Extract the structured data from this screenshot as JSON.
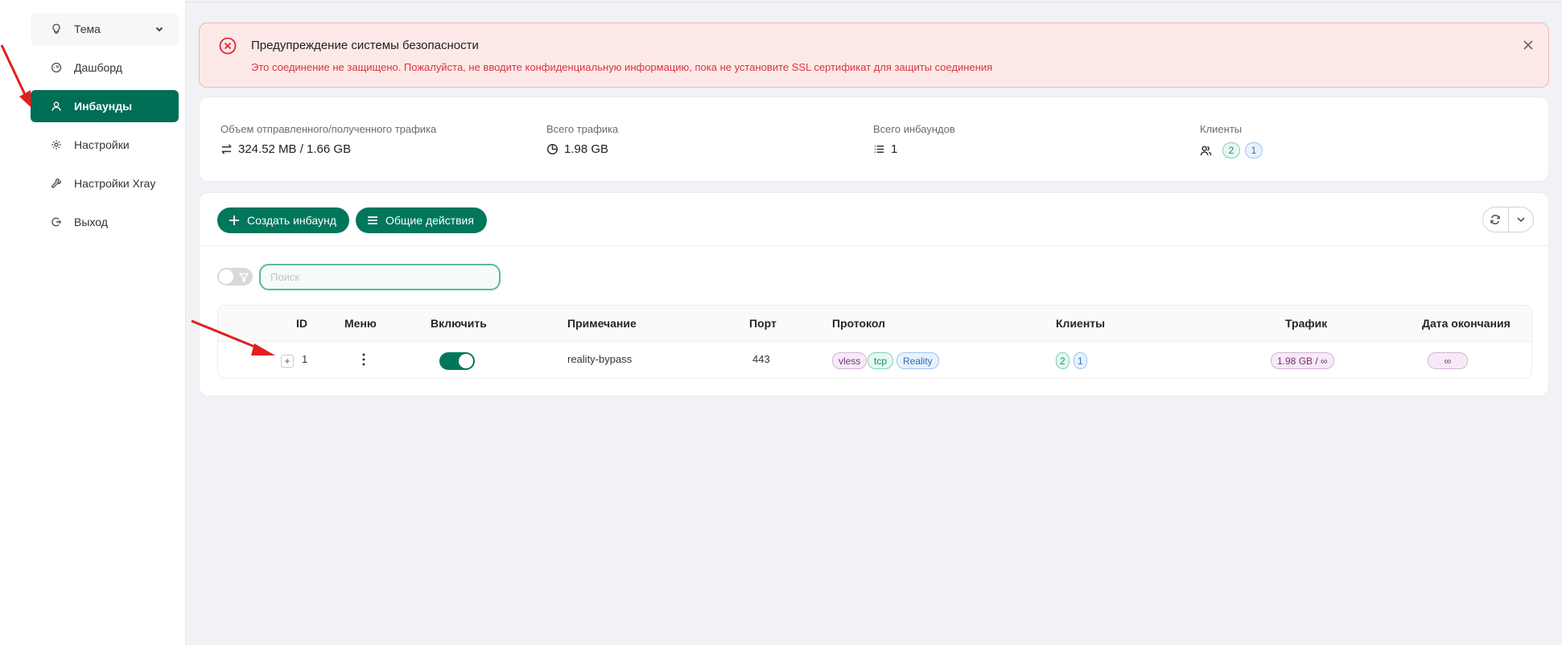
{
  "sidebar": {
    "items": [
      {
        "label": "Тема",
        "icon": "bulb-icon"
      },
      {
        "label": "Дашборд",
        "icon": "dashboard-icon"
      },
      {
        "label": "Инбаунды",
        "icon": "user-icon"
      },
      {
        "label": "Настройки",
        "icon": "gear-icon"
      },
      {
        "label": "Настройки Xray",
        "icon": "wrench-icon"
      },
      {
        "label": "Выход",
        "icon": "logout-icon"
      }
    ]
  },
  "alert": {
    "title": "Предупреждение системы безопасности",
    "text": "Это соединение не защищено. Пожалуйста, не вводите конфиденциальную информацию, пока не установите SSL сертификат для защиты соединения"
  },
  "stats": {
    "traffic_label": "Объем отправленного/полученного трафика",
    "traffic_value": "324.52 MB / 1.66 GB",
    "total_label": "Всего трафика",
    "total_value": "1.98 GB",
    "inbounds_label": "Всего инбаундов",
    "inbounds_value": "1",
    "clients_label": "Клиенты",
    "clients_green": "2",
    "clients_blue": "1"
  },
  "toolbar": {
    "create_label": "Создать инбаунд",
    "actions_label": "Общие действия"
  },
  "search": {
    "placeholder": "Поиск"
  },
  "table": {
    "headers": {
      "id": "ID",
      "menu": "Меню",
      "enable": "Включить",
      "remark": "Примечание",
      "port": "Порт",
      "protocol": "Протокол",
      "clients": "Клиенты",
      "traffic": "Трафик",
      "expiry": "Дата окончания"
    },
    "rows": [
      {
        "expand": "+",
        "id": "1",
        "enabled": true,
        "remark": "reality-bypass",
        "port": "443",
        "protocol_tags": [
          "vless",
          "tcp",
          "Reality"
        ],
        "clients_green": "2",
        "clients_blue": "1",
        "traffic": "1.98 GB / ∞",
        "expiry": "∞"
      }
    ]
  },
  "colors": {
    "accent": "#00775c",
    "sidebar_active": "#006d55",
    "alert_bg": "#fde8e8",
    "alert_text": "#d9363e",
    "annotation_arrow": "#e02020"
  }
}
